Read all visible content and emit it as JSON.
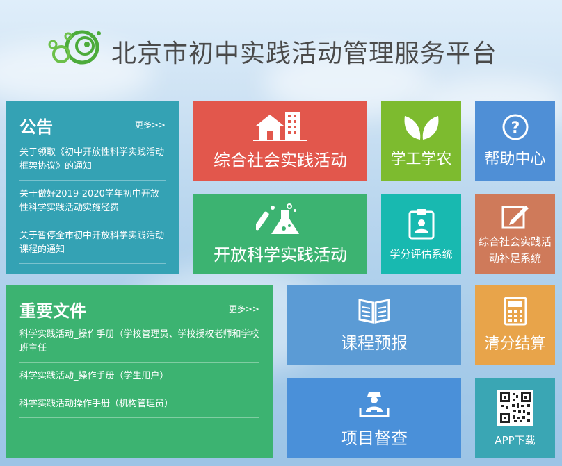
{
  "header": {
    "title": "北京市初中实践活动管理服务平台"
  },
  "notice": {
    "title": "公告",
    "more": "更多>>",
    "items": [
      "关于领取《初中开放性科学实践活动框架协议》的通知",
      "关于做好2019-2020学年初中开放性科学实践活动实施经费",
      "关于暂停全市初中开放科学实践活动课程的通知"
    ]
  },
  "documents": {
    "title": "重要文件",
    "more": "更多>>",
    "items": [
      "科学实践活动_操作手册（学校管理员、学校授权老师和学校班主任",
      "科学实践活动_操作手册（学生用户）",
      "科学实践活动操作手册（机构管理员）"
    ]
  },
  "tiles": {
    "social": {
      "label": "综合社会实践活动",
      "icon": "buildings-icon",
      "color": "#e2574c"
    },
    "agri": {
      "label": "学工学农",
      "icon": "leaves-icon",
      "color": "#7dbb2f"
    },
    "help": {
      "label": "帮助中心",
      "icon": "question-icon",
      "color": "#4f8fd6"
    },
    "science": {
      "label": "开放科学实践活动",
      "icon": "flask-icon",
      "color": "#3cb371"
    },
    "credit": {
      "label": "学分评估系统",
      "icon": "clipboard-user-icon",
      "color": "#18b9b0"
    },
    "supplement": {
      "label": "综合社会实践活动补足系统",
      "icon": "edit-icon",
      "color": "#cf7a5a"
    },
    "course": {
      "label": "课程预报",
      "icon": "book-icon",
      "color": "#5b9bd5"
    },
    "settle": {
      "label": "清分结算",
      "icon": "calculator-icon",
      "color": "#e8a44a"
    },
    "supervise": {
      "label": "项目督查",
      "icon": "inspector-icon",
      "color": "#4a90d9"
    },
    "app": {
      "label": "APP下载",
      "icon": "qr-code-icon",
      "color": "#3aa6b4"
    }
  }
}
